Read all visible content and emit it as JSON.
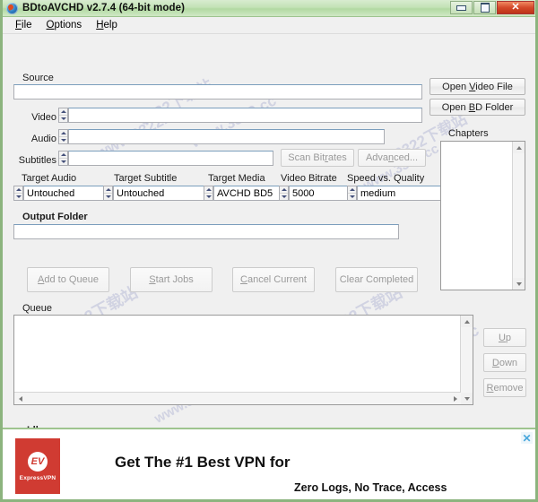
{
  "window": {
    "title": "BDtoAVCHD v2.7.4   (64-bit mode)",
    "icon": "app-disc-icon",
    "buttons": {
      "minimize": "minimize-icon",
      "maximize": "maximize-icon",
      "close": "✕"
    },
    "border_color": "#8cb47e",
    "titlebar_color": "#c3e2b6"
  },
  "menubar": {
    "items": [
      {
        "label": "File",
        "accel": "F"
      },
      {
        "label": "Options",
        "accel": "O"
      },
      {
        "label": "Help",
        "accel": "H"
      }
    ]
  },
  "source": {
    "group_label": "Source",
    "path_value": "",
    "path_placeholder": "",
    "rows": [
      {
        "label": "Video",
        "value": "",
        "spinner": "video-spinner"
      },
      {
        "label": "Audio",
        "value": "",
        "spinner": "audio-spinner"
      },
      {
        "label": "Subtitles",
        "value": "",
        "spinner": "subtitles-spinner"
      }
    ]
  },
  "source_buttons": {
    "open_video_file": "Open Video File",
    "open_video_file_accel": "V",
    "open_bd_folder": "Open BD Folder",
    "open_bd_folder_accel": "B"
  },
  "chapters": {
    "label": "Chapters",
    "items": []
  },
  "scan_buttons": {
    "scan_bitrates": "Scan Bitrates",
    "scan_bitrates_accel": "r",
    "advanced": "Advanced...",
    "advanced_accel": "n",
    "disabled": true
  },
  "targets": [
    {
      "label": "Target Audio",
      "value": "Untouched"
    },
    {
      "label": "Target Subtitle",
      "value": "Untouched"
    },
    {
      "label": "Target Media",
      "value": "AVCHD BD5"
    },
    {
      "label": "Video Bitrate",
      "value": "5000"
    },
    {
      "label": "Speed vs. Quality",
      "value": "medium"
    }
  ],
  "output": {
    "label": "Output Folder",
    "value": ""
  },
  "action_buttons": [
    {
      "label": "Add to Queue",
      "accel": "A",
      "disabled": true
    },
    {
      "label": "Start Jobs",
      "accel": "S",
      "disabled": true
    },
    {
      "label": "Cancel Current",
      "accel": "C",
      "disabled": true
    },
    {
      "label": "Clear Completed",
      "accel": "",
      "disabled": true
    }
  ],
  "queue": {
    "label": "Queue",
    "items": []
  },
  "queue_buttons": [
    {
      "label": "Up",
      "accel": "U",
      "disabled": true
    },
    {
      "label": "Down",
      "accel": "D",
      "disabled": true
    },
    {
      "label": "Remove",
      "accel": "R",
      "disabled": true
    }
  ],
  "status": {
    "text": "Idle",
    "progress_percent": 0,
    "progress_color": "#f5a416"
  },
  "ad": {
    "brand": "ExpressVPN",
    "brand_mark": "EV",
    "headline": "Get The #1 Best VPN for",
    "subline": "Zero Logs, No Trace, Access",
    "close": "✕",
    "brand_color": "#d03b32"
  },
  "watermarks": [
    "3322下载站",
    "www.3322.cc"
  ]
}
